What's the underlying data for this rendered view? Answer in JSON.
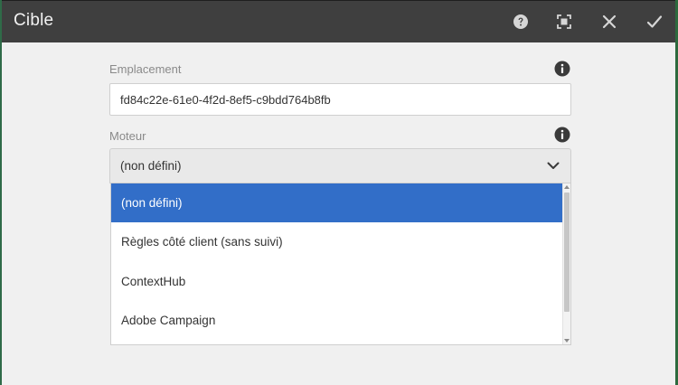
{
  "dialog": {
    "title": "Cible",
    "toolbar": {
      "help_icon": "help-icon",
      "fullscreen_icon": "fullscreen-icon",
      "close_icon": "close-icon",
      "confirm_icon": "checkmark-icon"
    }
  },
  "fields": {
    "location": {
      "label": "Emplacement",
      "value": "fd84c22e-61e0-4f2d-8ef5-c9bdd764b8fb",
      "info_icon": "info-icon"
    },
    "engine": {
      "label": "Moteur",
      "value": "(non défini)",
      "info_icon": "info-icon",
      "options": [
        {
          "label": "(non défini)",
          "selected": true
        },
        {
          "label": "Règles côté client (sans suivi)",
          "selected": false
        },
        {
          "label": "ContextHub",
          "selected": false
        },
        {
          "label": "Adobe Campaign",
          "selected": false
        }
      ]
    }
  },
  "colors": {
    "titlebar": "#3f3f3f",
    "selected_option": "#326ec8",
    "dialog_bg": "#f0f0f0"
  }
}
